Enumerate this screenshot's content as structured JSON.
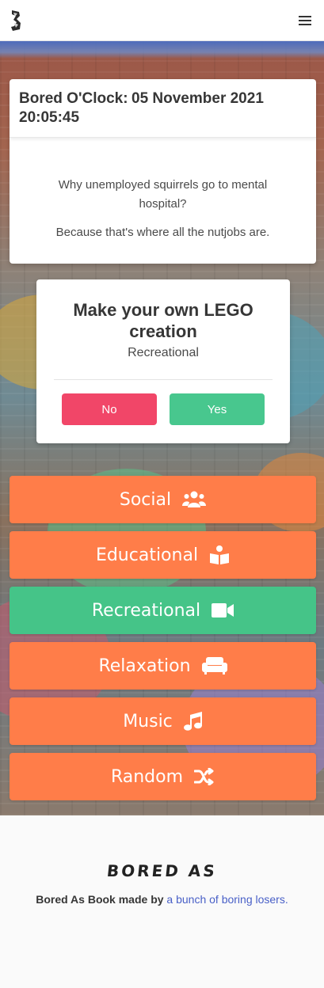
{
  "header": {
    "logo_icon": "bored-as-logo-icon",
    "menu_icon": "hamburger-menu-icon"
  },
  "clock": {
    "label": "Bored O'Clock:",
    "datetime": "05 November 2021 20:05:45"
  },
  "joke": {
    "question": "Why unemployed squirrels go to mental hospital?",
    "answer": "Because that's where all the nutjobs are."
  },
  "activity": {
    "name": "Make your own LEGO creation",
    "type": "Recreational",
    "no_label": "No",
    "yes_label": "Yes"
  },
  "categories": [
    {
      "label": "Social",
      "icon": "users-icon",
      "color": "#ff7d49"
    },
    {
      "label": "Educational",
      "icon": "book-reader-icon",
      "color": "#ff7d49"
    },
    {
      "label": "Recreational",
      "icon": "video-camera-icon",
      "color": "#45c488"
    },
    {
      "label": "Relaxation",
      "icon": "couch-icon",
      "color": "#ff7d49"
    },
    {
      "label": "Music",
      "icon": "music-note-icon",
      "color": "#ff7d49"
    },
    {
      "label": "Random",
      "icon": "shuffle-icon",
      "color": "#ff7d49"
    }
  ],
  "footer": {
    "brand": "BORED AS",
    "text": "Bored As Book made by",
    "link": "a bunch of boring losers."
  },
  "colors": {
    "danger": "#f14668",
    "success": "#48c78e",
    "accent": "#ff7d49",
    "link": "#485fc7"
  }
}
